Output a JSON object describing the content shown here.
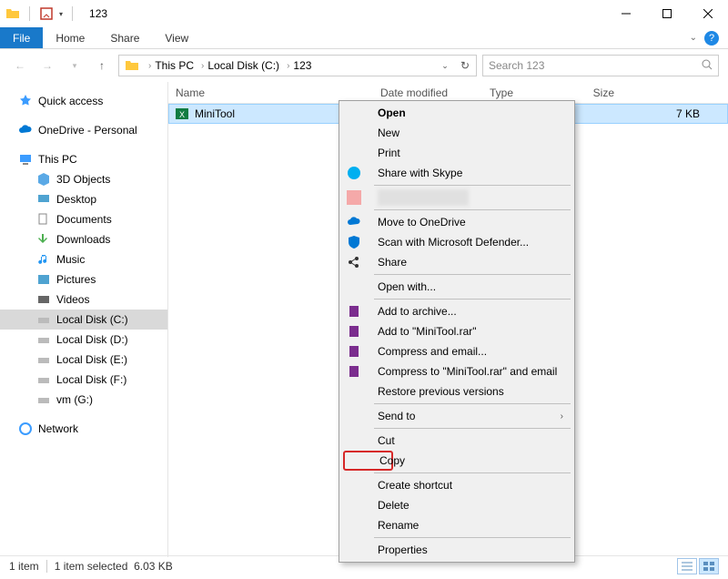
{
  "titlebar": {
    "title": "123"
  },
  "window_controls": {
    "min": "—",
    "max": "☐",
    "close": "✕"
  },
  "ribbon": {
    "file": "File",
    "tabs": [
      "Home",
      "Share",
      "View"
    ]
  },
  "breadcrumbs": [
    "This PC",
    "Local Disk (C:)",
    "123"
  ],
  "search": {
    "placeholder": "Search 123"
  },
  "sidebar": {
    "quick_access": "Quick access",
    "onedrive": "OneDrive - Personal",
    "this_pc": "This PC",
    "children": [
      {
        "label": "3D Objects"
      },
      {
        "label": "Desktop"
      },
      {
        "label": "Documents"
      },
      {
        "label": "Downloads"
      },
      {
        "label": "Music"
      },
      {
        "label": "Pictures"
      },
      {
        "label": "Videos"
      },
      {
        "label": "Local Disk (C:)"
      },
      {
        "label": "Local Disk (D:)"
      },
      {
        "label": "Local Disk (E:)"
      },
      {
        "label": "Local Disk (F:)"
      },
      {
        "label": "vm (G:)"
      }
    ],
    "network": "Network"
  },
  "columns": {
    "name": "Name",
    "date": "Date modified",
    "type": "Type",
    "size": "Size"
  },
  "file": {
    "name": "MiniTool",
    "size": "7 KB"
  },
  "context_menu": {
    "open": "Open",
    "new": "New",
    "print": "Print",
    "skype": "Share with Skype",
    "onedrive": "Move to OneDrive",
    "defender": "Scan with Microsoft Defender...",
    "share": "Share",
    "open_with": "Open with...",
    "add_archive": "Add to archive...",
    "add_rar": "Add to \"MiniTool.rar\"",
    "compress_email": "Compress and email...",
    "compress_rar_email": "Compress to \"MiniTool.rar\" and email",
    "restore": "Restore previous versions",
    "send_to": "Send to",
    "cut": "Cut",
    "copy": "Copy",
    "create_shortcut": "Create shortcut",
    "delete": "Delete",
    "rename": "Rename",
    "properties": "Properties"
  },
  "status": {
    "count": "1 item",
    "selected": "1 item selected",
    "size": "6.03 KB"
  }
}
